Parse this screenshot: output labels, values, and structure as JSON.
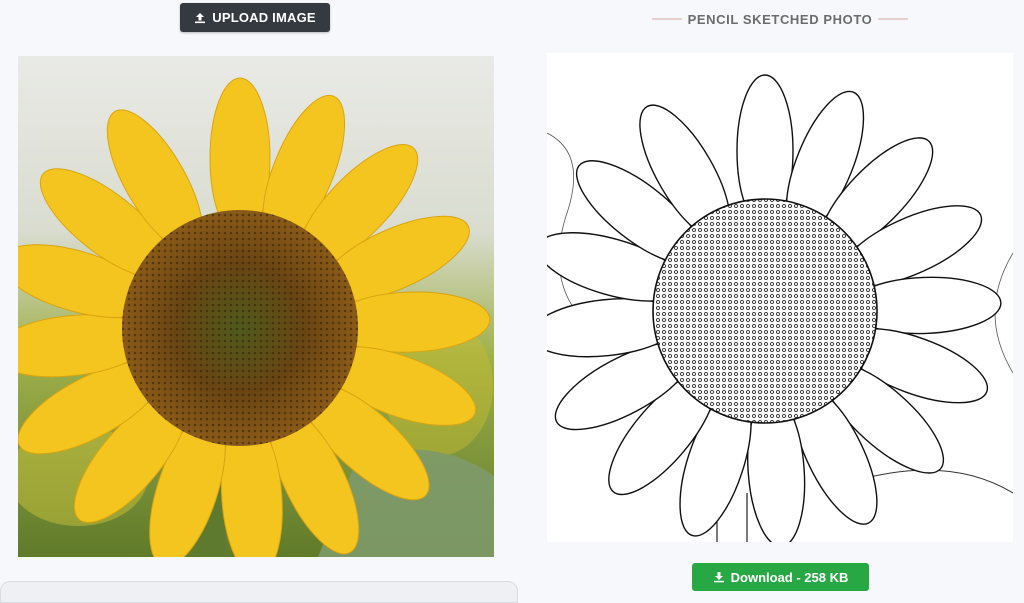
{
  "upload": {
    "label": "UPLOAD IMAGE",
    "icon": "upload-icon"
  },
  "result": {
    "title": "PENCIL SKETCHED PHOTO"
  },
  "download": {
    "label": "Download - 258 KB",
    "icon": "download-icon"
  },
  "colors": {
    "upload_bg": "#343a40",
    "download_bg": "#28a745",
    "page_bg": "#f6f8fb",
    "petal": "#f4c51f",
    "seedhead": "#5a3a10"
  }
}
